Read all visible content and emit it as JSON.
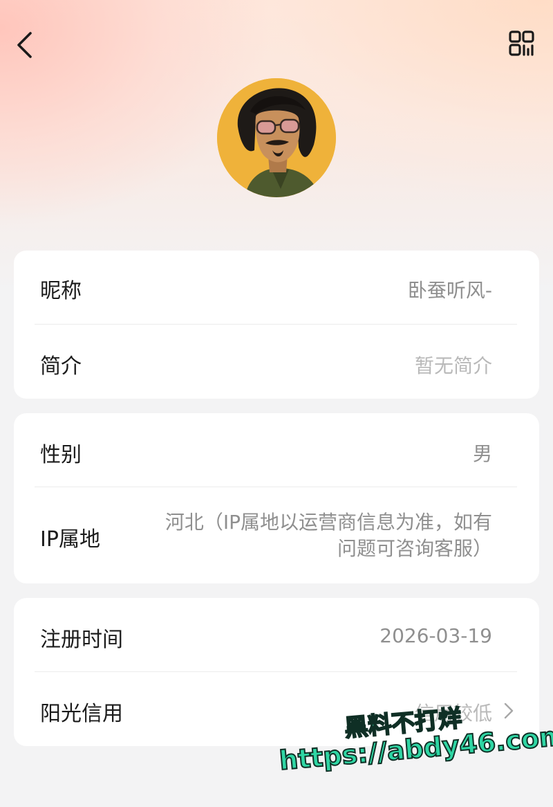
{
  "header": {
    "back_icon": "chevron-left-icon",
    "qr_icon": "qr-code-icon"
  },
  "profile": {
    "avatar": "user-avatar"
  },
  "section_basic": {
    "nickname_label": "昵称",
    "nickname_value": "卧蚕听风-",
    "bio_label": "简介",
    "bio_value": "暂无简介"
  },
  "section_personal": {
    "gender_label": "性别",
    "gender_value": "男",
    "ip_label": "IP属地",
    "ip_value_line1": "河北（IP属地以运营商信息为准，如有",
    "ip_value_line2": "问题可咨询客服）"
  },
  "section_account": {
    "register_label": "注册时间",
    "register_value": "2026-03-19",
    "credit_label": "阳光信用",
    "credit_value": "信用较低",
    "credit_arrow_icon": "chevron-right-icon"
  },
  "watermark": {
    "line1": "黑料不打烊",
    "line2": "https://abdy46.com"
  },
  "colors": {
    "label": "#1c1c1c",
    "value": "#8f8f8f",
    "placeholder": "#b9b9b9",
    "watermark": "#2fd6a4"
  }
}
